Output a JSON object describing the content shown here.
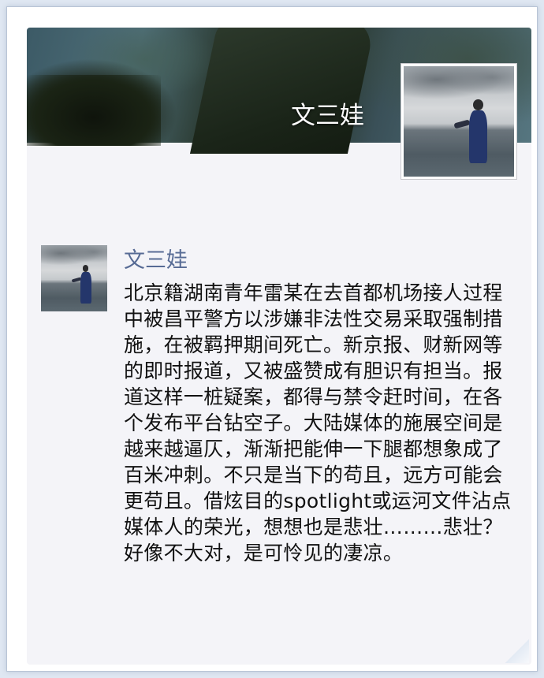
{
  "cover": {
    "name": "文三娃"
  },
  "post": {
    "author": "文三娃",
    "text": "北京籍湖南青年雷某在去首都机场接人过程中被昌平警方以涉嫌非法性交易采取强制措施，在被羁押期间死亡。新京报、财新网等的即时报道，又被盛赞成有胆识有担当。报道这样一桩疑案，都得与禁令赶时间，在各个发布平台钻空子。大陆媒体的施展空间是越来越逼仄，渐渐把能伸一下腿都想象成了百米冲刺。不只是当下的苟且，远方可能会更苟且。借炫目的spotlight或运河文件沾点媒体人的荣光，想想也是悲壮………悲壮？好像不大对，是可怜见的凄凉。"
  },
  "colors": {
    "page_background": "#dfe7f2",
    "card_background": "#f4f4f8",
    "author_name": "#576b95",
    "body_text": "#111111",
    "cover_name": "#ffffff"
  }
}
